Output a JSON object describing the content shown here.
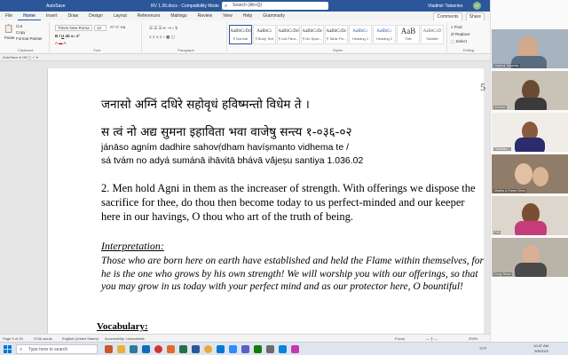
{
  "titlebar": {
    "autosave": "AutoSave",
    "document_title": "RV 1.36.docx - Compatibility Mode",
    "search_placeholder": "Search (Alt+Q)",
    "user_name": "Vladimir Tatsenko",
    "avatar_initials": "VT"
  },
  "tabs": [
    "File",
    "Home",
    "Insert",
    "Draw",
    "Design",
    "Layout",
    "References",
    "Mailings",
    "Review",
    "View",
    "Help",
    "Grammarly"
  ],
  "active_tab": "Home",
  "tab_actions": {
    "comments": "Comments",
    "share": "Share"
  },
  "ribbon": {
    "clipboard": {
      "paste": "Paste",
      "cut": "Cut",
      "copy": "Copy",
      "format_painter": "Format Painter",
      "label": "Clipboard"
    },
    "font": {
      "name": "Times New Roma",
      "size": "12",
      "label": "Font"
    },
    "paragraph": {
      "label": "Paragraph"
    },
    "styles": {
      "label": "Styles",
      "items": [
        {
          "sample": "AaBbCcDd",
          "name": "¶ Normal"
        },
        {
          "sample": "AaBbCc",
          "name": "¶ Body Text"
        },
        {
          "sample": "AaBbCcDd",
          "name": "¶ List Para..."
        },
        {
          "sample": "AaBbCcDc",
          "name": "¶ No Spac..."
        },
        {
          "sample": "AaBbCcDc",
          "name": "¶ Table Pa..."
        },
        {
          "sample": "AaBbCc",
          "name": "Heading 1"
        },
        {
          "sample": "AaBbCc",
          "name": "Heading 2"
        },
        {
          "sample": "AaB",
          "name": "Title"
        },
        {
          "sample": "AaBbCcD",
          "name": "Subtitle"
        }
      ]
    },
    "editing": {
      "find": "Find",
      "replace": "Replace",
      "select": "Select",
      "label": "Editing"
    },
    "dictate": "Dictate",
    "editor": "Editor",
    "grammarly": "Open Grammarly"
  },
  "ruler": {
    "autosave_label": "AutoSave ● Off ▢ ✓ ▾"
  },
  "document": {
    "page_number": "5",
    "sanskrit_line1": "जनासो अग्निं दधिरे सहोवृधं   हविष्मन्तो विधेम ते ।",
    "sanskrit_line2": "स त्वं नो अद्य सुमना इहाविता   भवा वाजेषु सन्त्य   १-०३६-०२",
    "translit_line1": "jánāso agním dadhire sahovṛ́dham  havíṣmanto vidhema te /",
    "translit_line2": "sá tvám no adyá sumánā ihāvitā  bhávā vā́jeṣu santiya  1.036.02",
    "verse_text": "2.  Men hold Agni in them as the increaser of strength. With offerings we dispose the sacrifice for thee, do thou then become today to us perfect-minded and our keeper here in our havings, O thou who art of the truth of being.",
    "interpretation_heading": "Interpretation:",
    "interpretation_text": "Those who are born here on earth have established and held the Flame within themselves, for he is the one who grows by his own strength! We will worship you with our offerings, so that you may grow in us today with your perfect mind and as our protector here, O bountiful!",
    "vocabulary_heading": "Vocabulary:"
  },
  "statusbar": {
    "page": "Page 5 of 25",
    "words": "3746 words",
    "language": "English (United States)",
    "accessibility": "Accessibility: Unavailable",
    "focus": "Focus",
    "zoom": "200%"
  },
  "taskbar": {
    "search_placeholder": "Type here to search",
    "weather": "72°F",
    "time": "10:37 AM",
    "date": "8/5/2022"
  },
  "video_panel": {
    "tiles": [
      {
        "name": "Vladimir Tatsenko"
      },
      {
        "name": "Arindam"
      },
      {
        "name": "Thankam ..."
      },
      {
        "name": "Martha & Robert Gries"
      },
      {
        "name": "Priti"
      },
      {
        "name": "Doug Simon"
      }
    ]
  }
}
